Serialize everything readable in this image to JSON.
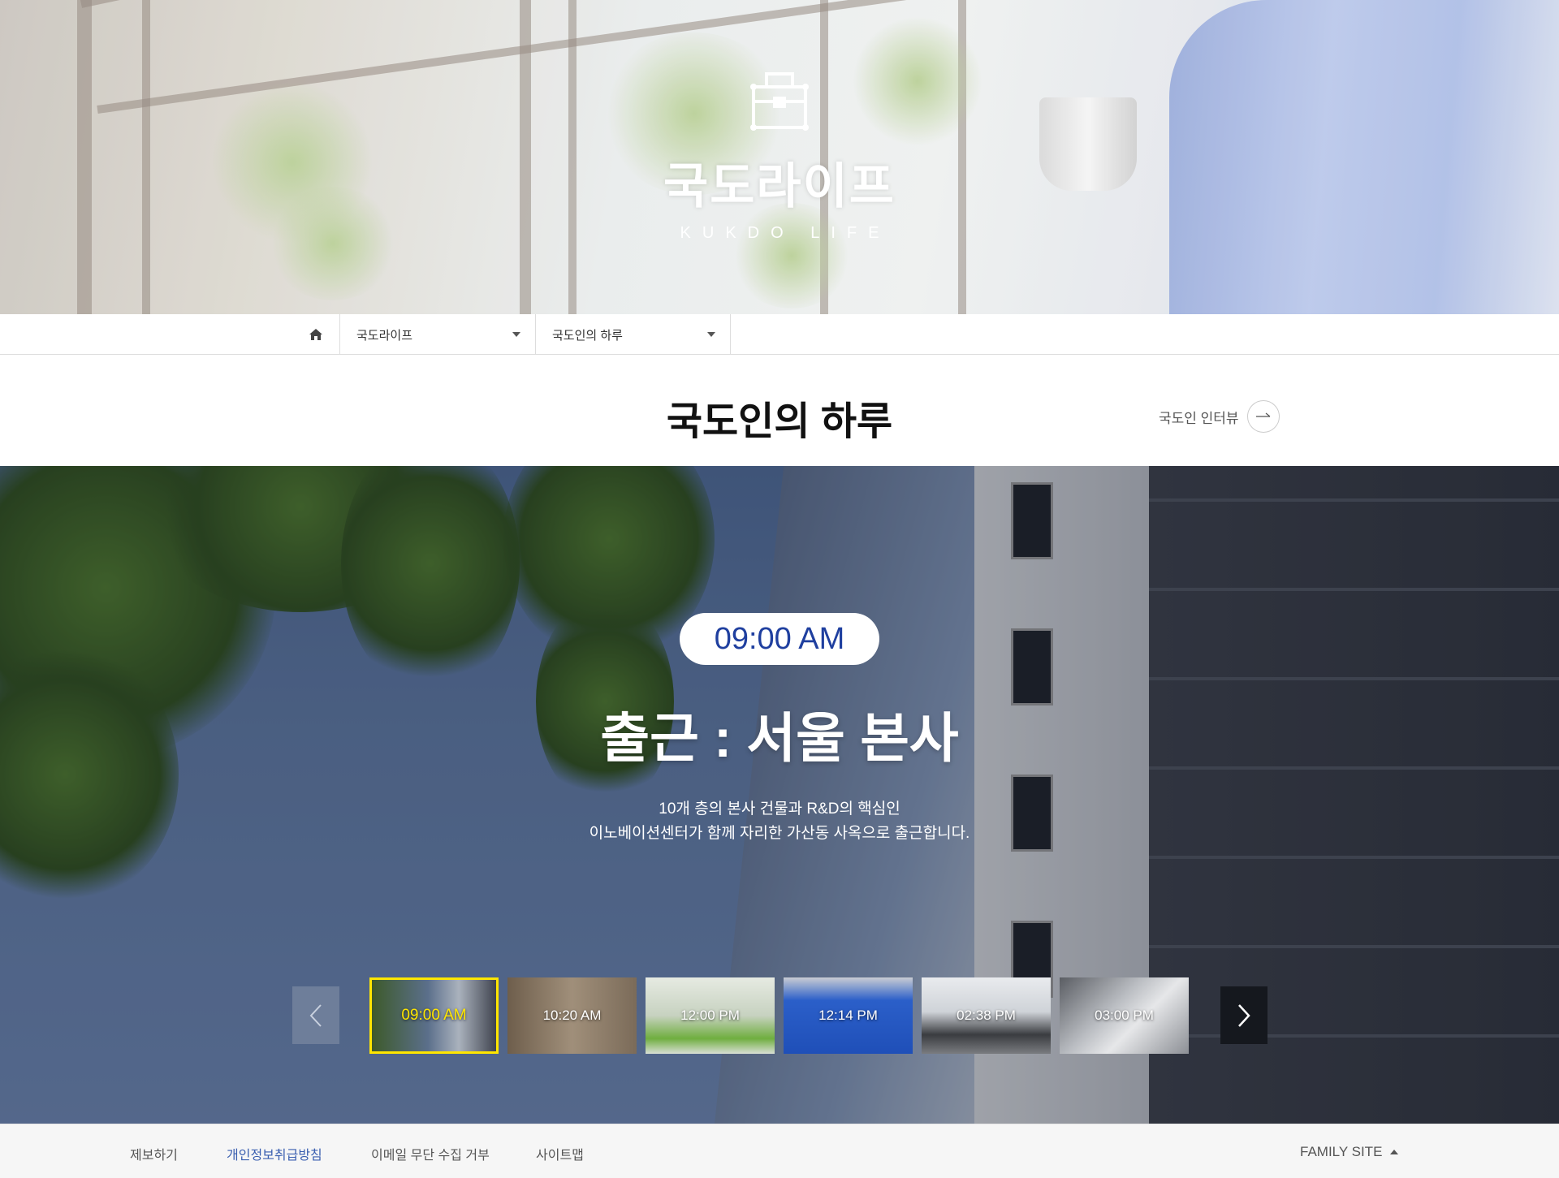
{
  "hero": {
    "title": "국도라이프",
    "subtitle": "KUKDO LIFE"
  },
  "breadcrumb": {
    "menu1": "국도라이프",
    "menu2": "국도인의 하루"
  },
  "page": {
    "title": "국도인의 하루",
    "link_label": "국도인 인터뷰"
  },
  "slide": {
    "time": "09:00 AM",
    "title": "출근 : 서울 본사",
    "desc_line1": "10개 층의 본사 건물과 R&D의 핵심인",
    "desc_line2": "이노베이션센터가 함께 자리한 가산동 사옥으로 출근합니다."
  },
  "thumbs": [
    "09:00 AM",
    "10:20 AM",
    "12:00 PM",
    "12:14 PM",
    "02:38 PM",
    "03:00 PM"
  ],
  "active_thumb": 0,
  "footer": {
    "links": [
      "제보하기",
      "개인정보취급방침",
      "이메일 무단 수집 거부",
      "사이트맵"
    ],
    "family_site": "FAMILY SITE"
  },
  "colors": {
    "accent": "#1f3f9f",
    "active_thumb_border": "#ffe600",
    "privacy_link": "#3a5fb0"
  }
}
